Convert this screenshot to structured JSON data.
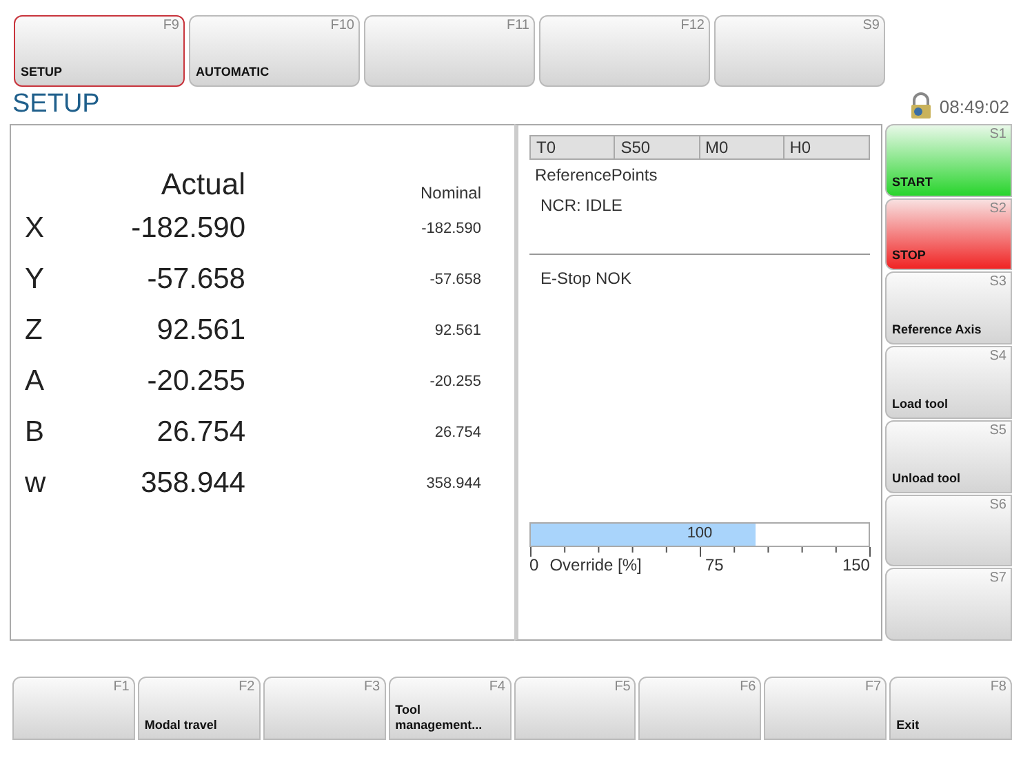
{
  "top_keys": [
    {
      "key": "F9",
      "label": "SETUP",
      "selected": true
    },
    {
      "key": "F10",
      "label": "AUTOMATIC",
      "selected": false
    },
    {
      "key": "F11",
      "selected": false
    },
    {
      "key": "F12",
      "selected": false
    },
    {
      "key": "S9",
      "selected": false
    }
  ],
  "page_title": "SETUP",
  "clock": "08:49:02",
  "axes": {
    "actual_header": "Actual",
    "nominal_header": "Nominal",
    "rows": [
      {
        "axis": "X",
        "actual": "-182.590",
        "nominal": "-182.590"
      },
      {
        "axis": "Y",
        "actual": "-57.658",
        "nominal": "-57.658"
      },
      {
        "axis": "Z",
        "actual": "92.561",
        "nominal": "92.561"
      },
      {
        "axis": "A",
        "actual": "-20.255",
        "nominal": "-20.255"
      },
      {
        "axis": "B",
        "actual": "26.754",
        "nominal": "26.754"
      },
      {
        "axis": "w",
        "actual": "358.944",
        "nominal": "358.944"
      }
    ]
  },
  "status": {
    "cells": [
      "T0",
      "S50",
      "M0",
      "H0"
    ],
    "mode": "ReferencePoints",
    "ncr": "NCR: IDLE",
    "message": "E-Stop NOK"
  },
  "override": {
    "level": 0.667,
    "reading": "100",
    "label": "Override [%]",
    "ticks": [
      "0",
      "75",
      "150"
    ]
  },
  "side_keys": [
    {
      "key": "S1",
      "label": "START",
      "kind": "start"
    },
    {
      "key": "S2",
      "label": "STOP",
      "kind": "stop"
    },
    {
      "key": "S3",
      "label": "Reference Axis",
      "kind": "plain"
    },
    {
      "key": "S4",
      "label": "Load tool",
      "kind": "plain"
    },
    {
      "key": "S5",
      "label": "Unload tool",
      "kind": "plain"
    },
    {
      "key": "S6",
      "kind": "plain"
    },
    {
      "key": "S7",
      "kind": "plain"
    }
  ],
  "bottom_keys": [
    {
      "key": "F1"
    },
    {
      "key": "F2",
      "label": "Modal travel"
    },
    {
      "key": "F3"
    },
    {
      "key": "F4",
      "label": "Tool management..."
    },
    {
      "key": "F5"
    },
    {
      "key": "F6"
    },
    {
      "key": "F7"
    },
    {
      "key": "F8",
      "label": "Exit"
    }
  ]
}
